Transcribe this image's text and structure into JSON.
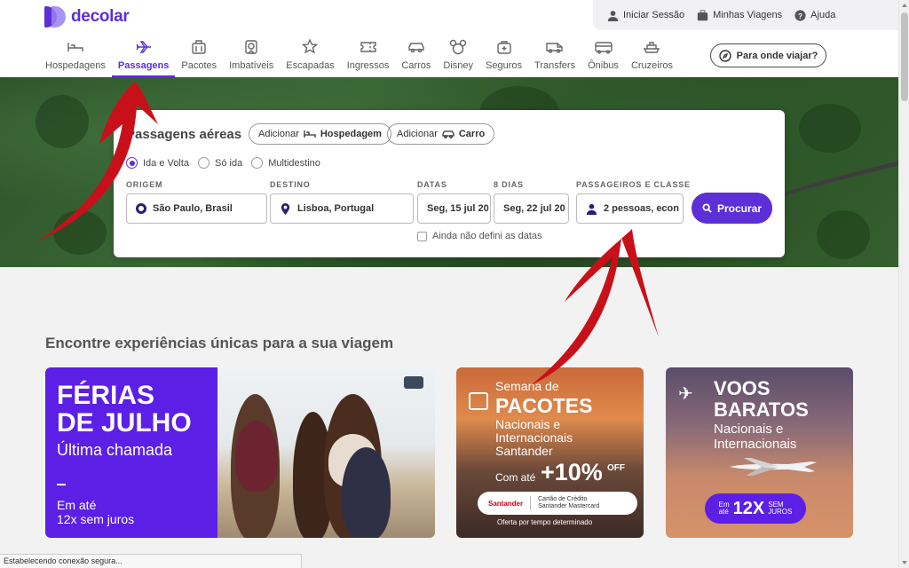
{
  "brand": {
    "name": "decolar",
    "color": "#5c2fd7"
  },
  "util_bar": {
    "items": [
      {
        "label": "Iniciar Sessão",
        "icon": "user-icon"
      },
      {
        "label": "Minhas Viagens",
        "icon": "suitcase-icon"
      },
      {
        "label": "Ajuda",
        "icon": "help-icon"
      }
    ]
  },
  "nav": {
    "items": [
      {
        "label": "Hospedagens",
        "icon": "bed-icon",
        "active": false
      },
      {
        "label": "Passagens",
        "icon": "plane-icon",
        "active": true
      },
      {
        "label": "Pacotes",
        "icon": "luggage-icon",
        "active": false
      },
      {
        "label": "Imbatíveis",
        "icon": "badge-icon",
        "active": false
      },
      {
        "label": "Escapadas",
        "icon": "star-plane-icon",
        "active": false
      },
      {
        "label": "Ingressos",
        "icon": "ticket-icon",
        "active": false
      },
      {
        "label": "Carros",
        "icon": "car-icon",
        "active": false
      },
      {
        "label": "Disney",
        "icon": "mickey-icon",
        "active": false
      },
      {
        "label": "Seguros",
        "icon": "shield-bag-icon",
        "active": false
      },
      {
        "label": "Transfers",
        "icon": "van-icon",
        "active": false
      },
      {
        "label": "Ônibus",
        "icon": "bus-icon",
        "active": false
      },
      {
        "label": "Cruzeiros",
        "icon": "ship-icon",
        "active": false
      }
    ],
    "where_button": "Para onde viajar?"
  },
  "search": {
    "title": "Passagens aéreas",
    "add_hotel": {
      "prefix": "Adicionar",
      "label": "Hospedagem"
    },
    "add_car": {
      "prefix": "Adicionar",
      "label": "Carro"
    },
    "trip_types": [
      {
        "label": "Ida e Volta",
        "checked": true
      },
      {
        "label": "Só ida",
        "checked": false
      },
      {
        "label": "Multidestino",
        "checked": false
      }
    ],
    "labels": {
      "origin": "ORIGEM",
      "destination": "DESTINO",
      "dates": "DATAS",
      "days": "8 DIAS",
      "passengers": "PASSAGEIROS E CLASSE"
    },
    "origin": "São Paulo, Brasil",
    "destination": "Lisboa, Portugal",
    "date_out": "Seg, 15 jul 20",
    "date_back": "Seg, 22 jul 20",
    "passengers": "2 pessoas, econ",
    "search_button": "Procurar",
    "undefined_dates": "Ainda não defini as datas"
  },
  "experiences": {
    "title": "Encontre experiências únicas para a sua viagem",
    "card1": {
      "line1": "FÉRIAS",
      "line2": "DE JULHO",
      "subtitle": "Última chamada",
      "offer1": "Em até",
      "offer2": "12x sem juros"
    },
    "card2": {
      "line1": "Semana de",
      "line2": "PACOTES",
      "line3": "Nacionais e",
      "line4": "Internacionais",
      "line5": "Santander",
      "prefix": "Com até",
      "discount": "+10%",
      "off": "OFF",
      "bank": "Santander",
      "card_line1": "Cartão de Crédito",
      "card_line2": "Santander Mastercard",
      "disclaimer": "Oferta por tempo determinado"
    },
    "card3": {
      "line1": "VOOS",
      "line2": "BARATOS",
      "line3": "Nacionais e",
      "line4": "Internacionais",
      "badge_small1": "Em",
      "badge_small2": "até",
      "badge_big": "12X",
      "badge_tail1": "SEM",
      "badge_tail2": "JUROS"
    }
  },
  "status_bar": "Estabelecendo conexão segura..."
}
